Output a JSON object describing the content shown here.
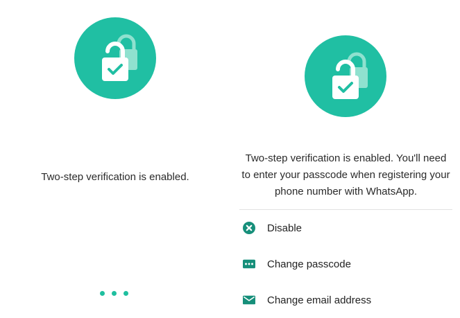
{
  "colors": {
    "accent": "#20bfa3",
    "accent_light": "#8fe1cf",
    "icon_dark": "#168f7a",
    "dot": "#1fbf9f",
    "divider": "#e2e2e2",
    "text": "#2a2a2a",
    "background": "#ffffff"
  },
  "left_screen": {
    "icon": "lock-check-icon",
    "status_text": "Two-step verification is enabled.",
    "progress_indicator": "loading-dots"
  },
  "right_screen": {
    "icon": "lock-check-icon",
    "status_text": "Two-step verification is enabled. You'll need to enter your passcode when registering your phone number with WhatsApp.",
    "options": [
      {
        "label": "Disable",
        "icon": "close-circle-icon"
      },
      {
        "label": "Change passcode",
        "icon": "passcode-icon"
      },
      {
        "label": "Change email address",
        "icon": "email-icon"
      }
    ]
  }
}
